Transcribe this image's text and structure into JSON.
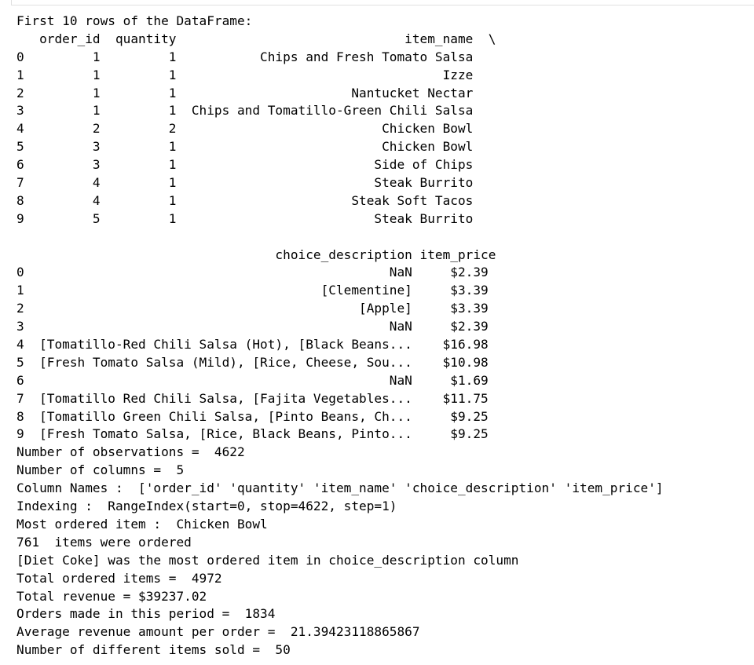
{
  "output": {
    "lines": [
      "First 10 rows of the DataFrame:",
      "   order_id  quantity                              item_name  \\",
      "0         1         1           Chips and Fresh Tomato Salsa   ",
      "1         1         1                                   Izze   ",
      "2         1         1                       Nantucket Nectar   ",
      "3         1         1  Chips and Tomatillo-Green Chili Salsa   ",
      "4         2         2                           Chicken Bowl   ",
      "5         3         1                           Chicken Bowl   ",
      "6         3         1                          Side of Chips   ",
      "7         4         1                          Steak Burrito   ",
      "8         4         1                       Steak Soft Tacos   ",
      "9         5         1                          Steak Burrito   ",
      "",
      "                                  choice_description item_price  ",
      "0                                                NaN     $2.39   ",
      "1                                       [Clementine]     $3.39   ",
      "2                                            [Apple]     $3.39   ",
      "3                                                NaN     $2.39   ",
      "4  [Tomatillo-Red Chili Salsa (Hot), [Black Beans...    $16.98   ",
      "5  [Fresh Tomato Salsa (Mild), [Rice, Cheese, Sou...    $10.98   ",
      "6                                                NaN     $1.69   ",
      "7  [Tomatillo Red Chili Salsa, [Fajita Vegetables...    $11.75   ",
      "8  [Tomatillo Green Chili Salsa, [Pinto Beans, Ch...     $9.25   ",
      "9  [Fresh Tomato Salsa, [Rice, Black Beans, Pinto...     $9.25   ",
      "Number of observations =  4622",
      "Number of columns =  5",
      "Column Names :  ['order_id' 'quantity' 'item_name' 'choice_description' 'item_price']",
      "Indexing :  RangeIndex(start=0, stop=4622, step=1)",
      "Most ordered item :  Chicken Bowl",
      "761  items were ordered",
      "[Diet Coke] was the most ordered item in choice_description column",
      "Total ordered items =  4972",
      "Total revenue = $39237.02",
      "Orders made in this period =  1834",
      "Average revenue amount per order =  21.39423118865867",
      "Number of different items sold =  50"
    ]
  }
}
